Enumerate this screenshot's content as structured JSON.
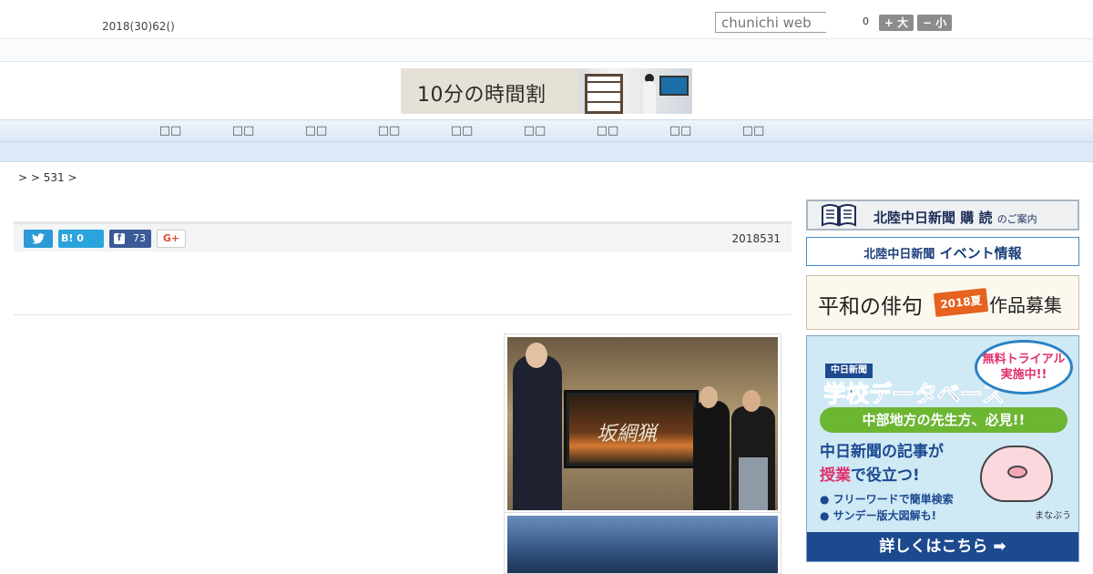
{
  "header": {
    "date": "2018(30)62()",
    "search_placeholder": "chunichi web",
    "font_count": "0",
    "font_larger": "+ 大",
    "font_smaller": "− 小"
  },
  "banner": {
    "title": "10分の時間割"
  },
  "nav": {
    "items": [
      "□□",
      "□□",
      "□□",
      "□□",
      "□□",
      "□□",
      "□□",
      "□□",
      "□□"
    ]
  },
  "breadcrumb": ">  > 531 >",
  "share": {
    "hatena_label": "B!",
    "hatena_count": "0",
    "facebook_count": "73",
    "google_plus": "G+"
  },
  "article": {
    "date": "2018531",
    "photo_screen_text": "坂網猟"
  },
  "sidebar": {
    "subscribe": {
      "main": "北陸中日新聞 購 読",
      "sub": "のご案内"
    },
    "event": {
      "paper": "北陸中日新聞",
      "label": "イベント情報"
    },
    "haiku": {
      "left": "平和の俳句",
      "badge": "2018夏",
      "right": "作品募集"
    },
    "database": {
      "paper_logo": "中日新聞",
      "title": "学校データベース",
      "trial": "無料トライアル実施中!!",
      "teachers": "中部地方の先生方、必見!!",
      "line1": "中日新聞の記事が",
      "line2_hl": "授業",
      "line2_rest": "で役立つ!",
      "bullet1": "● フリーワードで簡単検索",
      "bullet2": "● サンデー版大図解も!",
      "mascot": "まなぶう",
      "more": "詳しくはこちら ➡"
    }
  },
  "colors": {
    "nav_bg": "#dbe8f5",
    "twitter": "#2b9ad6",
    "hatena": "#2aa4dc",
    "facebook": "#3b5a98",
    "db_blue": "#1d4a8f"
  }
}
